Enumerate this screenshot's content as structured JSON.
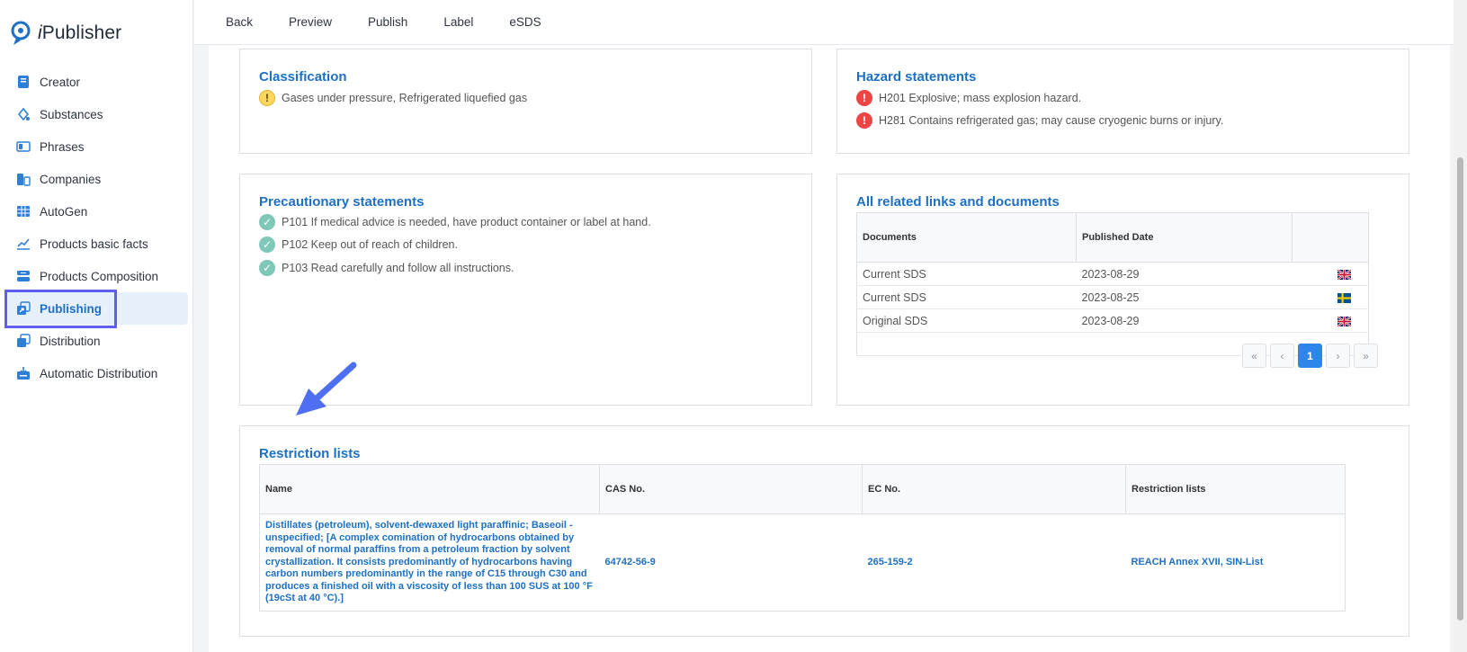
{
  "app": {
    "logo_prefix": "i",
    "logo_name": "Publisher"
  },
  "sidebar": {
    "items": [
      {
        "label": "Creator",
        "icon": "book-icon"
      },
      {
        "label": "Substances",
        "icon": "flask-icon"
      },
      {
        "label": "Phrases",
        "icon": "columns-icon"
      },
      {
        "label": "Companies",
        "icon": "building-icon"
      },
      {
        "label": "AutoGen",
        "icon": "grid-icon"
      },
      {
        "label": "Products basic facts",
        "icon": "chart-icon"
      },
      {
        "label": "Products Composition",
        "icon": "layers-icon"
      },
      {
        "label": "Publishing",
        "icon": "publish-icon",
        "active": true
      },
      {
        "label": "Distribution",
        "icon": "stack-icon"
      },
      {
        "label": "Automatic Distribution",
        "icon": "inbox-icon"
      }
    ]
  },
  "topbar": {
    "tabs": [
      "Back",
      "Preview",
      "Publish",
      "Label",
      "eSDS"
    ]
  },
  "classification": {
    "title": "Classification",
    "items": [
      {
        "text": "Gases under pressure, Refrigerated liquefied gas",
        "icon": "exclamation-icon",
        "level": "warning"
      }
    ]
  },
  "hazard": {
    "title": "Hazard statements",
    "items": [
      {
        "text": "H201 Explosive; mass explosion hazard.",
        "icon": "exclamation-icon",
        "level": "danger"
      },
      {
        "text": "H281 Contains refrigerated gas; may cause cryogenic burns or injury.",
        "icon": "exclamation-icon",
        "level": "danger"
      }
    ]
  },
  "precautionary": {
    "title": "Precautionary statements",
    "items": [
      {
        "text": "P101 If medical advice is needed, have product container or label at hand.",
        "icon": "check-icon"
      },
      {
        "text": "P102 Keep out of reach of children.",
        "icon": "check-icon"
      },
      {
        "text": "P103 Read carefully and follow all instructions.",
        "icon": "check-icon"
      }
    ]
  },
  "links": {
    "title": "All related links and documents",
    "columns": [
      "Documents",
      "Published Date",
      ""
    ],
    "rows": [
      {
        "document": "Current SDS",
        "date": "2023-08-29",
        "flag": "uk-flag-icon"
      },
      {
        "document": "Current SDS",
        "date": "2023-08-25",
        "flag": "sweden-flag-icon"
      },
      {
        "document": "Original SDS",
        "date": "2023-08-29",
        "flag": "uk-flag-icon"
      }
    ],
    "pagination": {
      "first": "«",
      "prev": "‹",
      "page": "1",
      "next": "›",
      "last": "»"
    }
  },
  "restriction": {
    "title": "Restriction lists",
    "columns": [
      "Name",
      "CAS No.",
      "EC No.",
      "Restriction lists"
    ],
    "rows": [
      {
        "name": "Distillates (petroleum), solvent-dewaxed light paraffinic; Baseoil - unspecified; [A complex comination of hydrocarbons obtained by removal of normal paraffins from a petroleum fraction by solvent crystallization. It consists predominantly of hydrocarbons having carbon numbers predominantly in the range of C15 through C30 and produces a finished oil with a viscosity of less than 100 SUS at 100 °F (19cSt at 40 °C).]",
        "cas": "64742-56-9",
        "ec": "265-159-2",
        "lists": "REACH Annex XVII, SIN-List"
      }
    ]
  },
  "colors": {
    "accent": "#1d70c4",
    "highlight_box": "#5e5ff0",
    "arrow": "#4f6ff2",
    "danger": "#ef4444",
    "warning": "#fbd75b",
    "ok": "#7fc7b8"
  }
}
